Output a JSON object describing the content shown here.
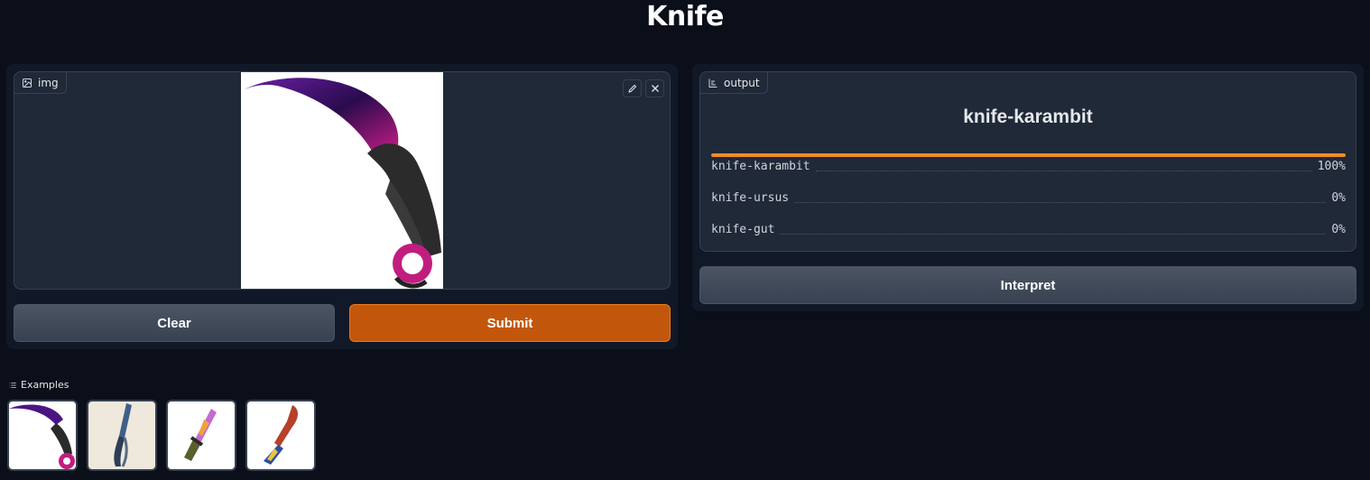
{
  "page": {
    "title": "Knife"
  },
  "input": {
    "label": "img",
    "icon": "image-icon",
    "edit_icon": "pencil-icon",
    "close_icon": "close-icon"
  },
  "buttons": {
    "clear": "Clear",
    "submit": "Submit",
    "interpret": "Interpret"
  },
  "output": {
    "label": "output",
    "icon": "bar-chart-icon",
    "top_label": "knife-karambit",
    "confidences": [
      {
        "label": "knife-karambit",
        "value": "100%",
        "fraction": 1.0
      },
      {
        "label": "knife-ursus",
        "value": "0%",
        "fraction": 0.0
      },
      {
        "label": "knife-gut",
        "value": "0%",
        "fraction": 0.0
      }
    ]
  },
  "examples": {
    "label": "Examples",
    "icon": "list-icon",
    "items": [
      "karambit-example",
      "butterfly-example",
      "bowie-example",
      "huntsman-example"
    ]
  },
  "colors": {
    "accent": "#c2570c",
    "bar": "#f28c28",
    "background": "#0b0f19"
  }
}
